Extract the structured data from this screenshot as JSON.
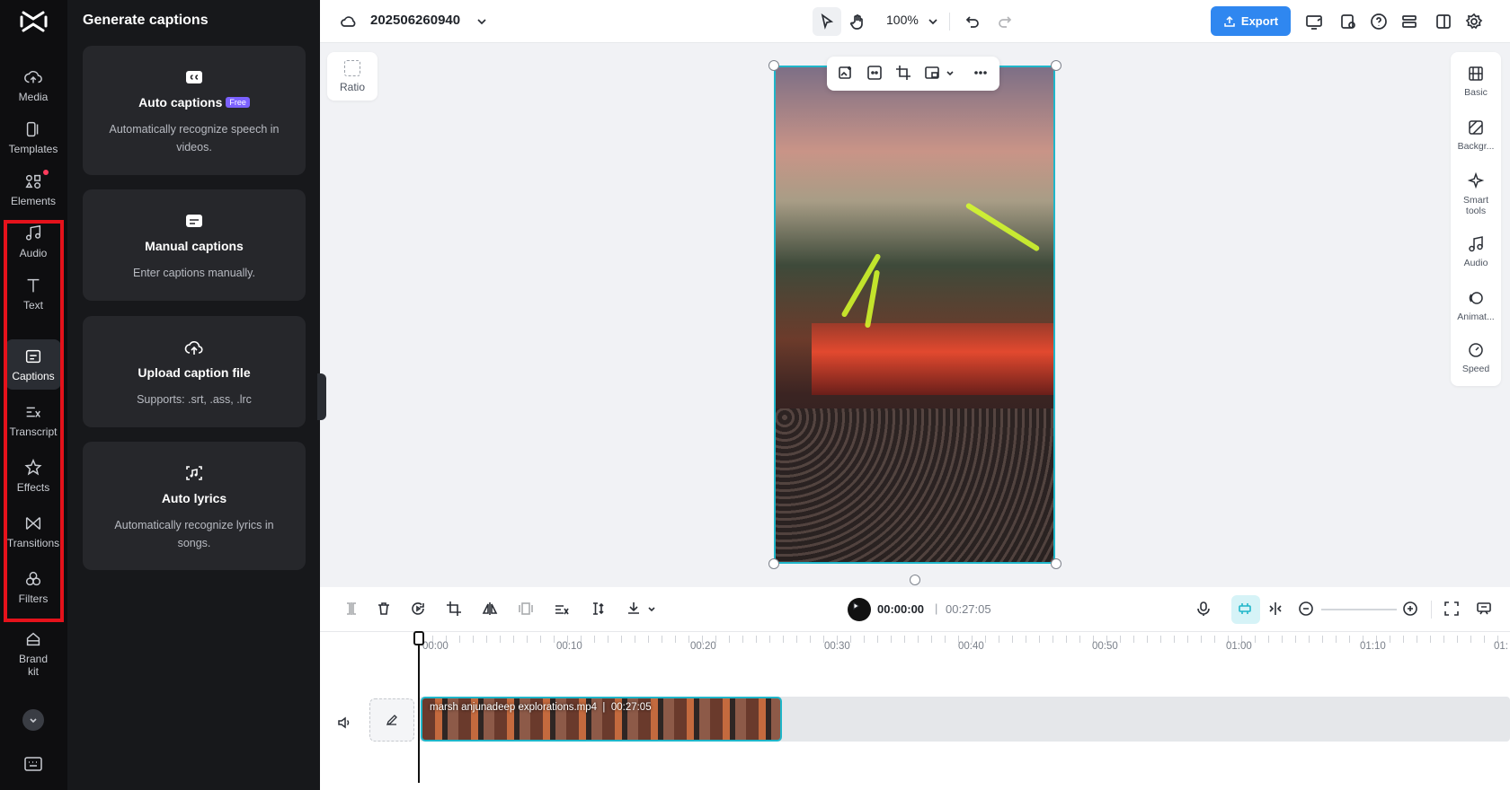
{
  "sidebar": {
    "items": [
      {
        "label": "Media"
      },
      {
        "label": "Templates"
      },
      {
        "label": "Elements"
      },
      {
        "label": "Audio"
      },
      {
        "label": "Text"
      },
      {
        "label": "Captions"
      },
      {
        "label": "Transcript"
      },
      {
        "label": "Effects"
      },
      {
        "label": "Transitions"
      },
      {
        "label": "Filters"
      },
      {
        "label": "Brand kit"
      }
    ],
    "active": "Captions"
  },
  "panel": {
    "title": "Generate captions",
    "cards": [
      {
        "title": "Auto captions",
        "badge": "Free",
        "desc": "Automatically recognize speech in videos."
      },
      {
        "title": "Manual captions",
        "desc": "Enter captions manually."
      },
      {
        "title": "Upload caption file",
        "desc": "Supports: .srt, .ass, .lrc"
      },
      {
        "title": "Auto lyrics",
        "desc": "Automatically recognize lyrics in songs."
      }
    ]
  },
  "topbar": {
    "project_name": "202506260940",
    "zoom": "100%",
    "export_label": "Export"
  },
  "canvas": {
    "ratio_label": "Ratio"
  },
  "right_tools": [
    {
      "label": "Basic"
    },
    {
      "label": "Backgr..."
    },
    {
      "label": "Smart tools"
    },
    {
      "label": "Audio"
    },
    {
      "label": "Animat..."
    },
    {
      "label": "Speed"
    }
  ],
  "timeline": {
    "current_time": "00:00:00",
    "separator": "|",
    "total_time": "00:27:05",
    "ruler": [
      "00:00",
      "00:10",
      "00:20",
      "00:30",
      "00:40",
      "00:50",
      "01:00",
      "01:10",
      "01:"
    ],
    "clip": {
      "name": "marsh anjunadeep explorations.mp4",
      "duration": "00:27:05"
    }
  },
  "colors": {
    "accent": "#2f87f0",
    "selection": "#1fb6c9",
    "highlight_box": "#e5121b",
    "badge": "#7b61ff"
  }
}
